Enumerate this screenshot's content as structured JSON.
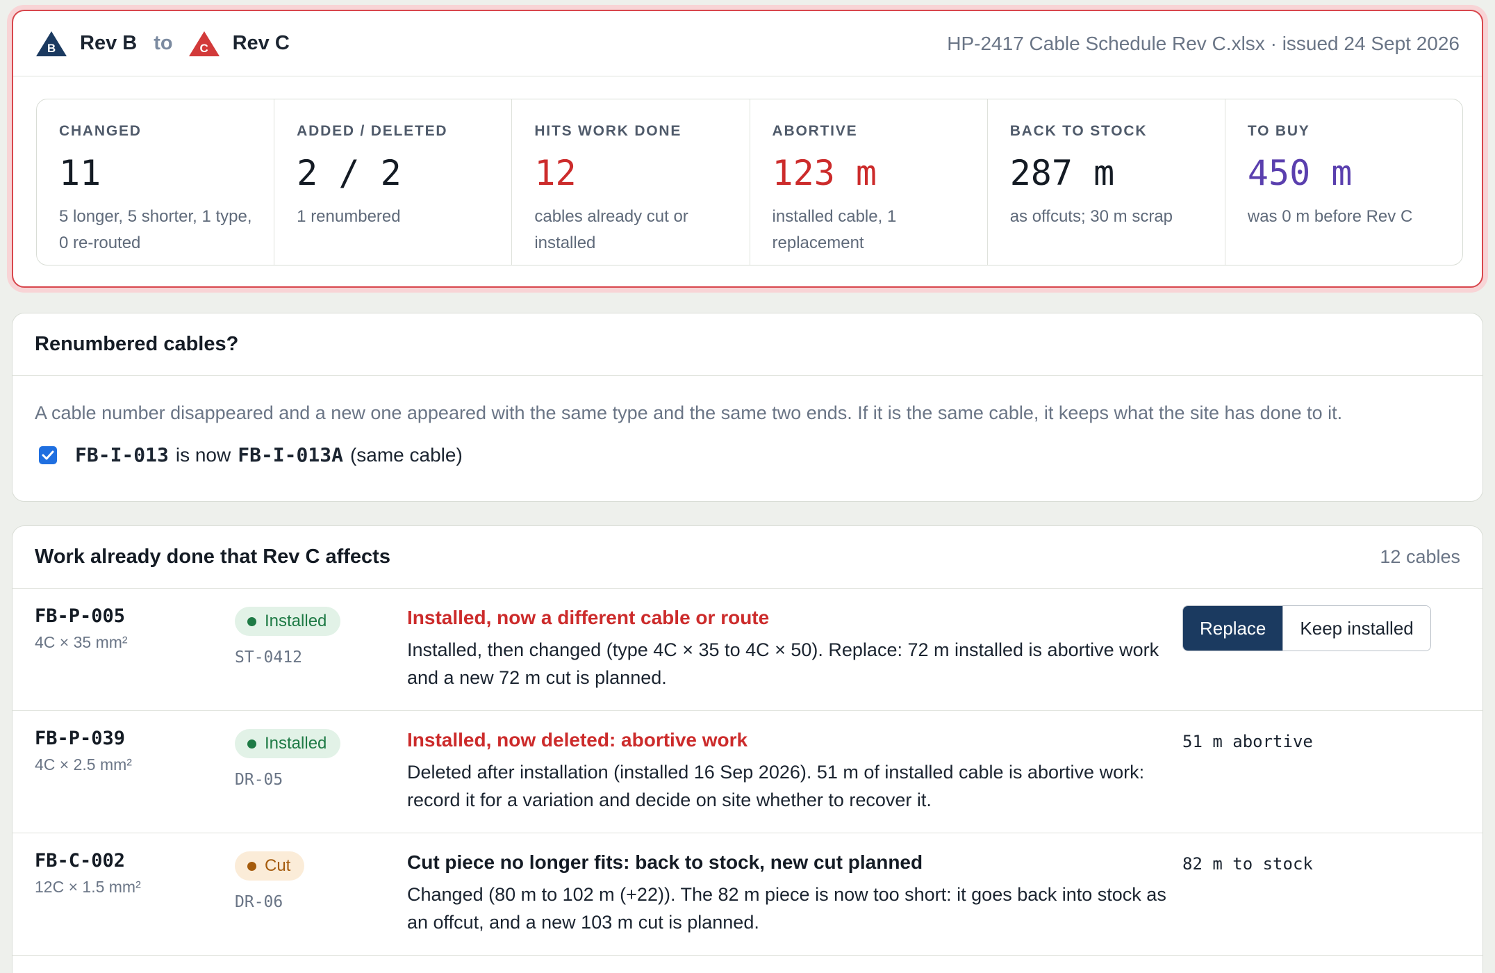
{
  "comparison": {
    "from_badge": "B",
    "from_label": "Rev B",
    "to_word": "to",
    "to_badge": "C",
    "to_label": "Rev C",
    "file_info": "HP-2417 Cable Schedule Rev C.xlsx · issued 24 Sept 2026",
    "colors": {
      "rev_b": "#1b3a60",
      "rev_c": "#d23a3a",
      "highlight_border": "#d8474d"
    }
  },
  "stats": [
    {
      "label": "Changed",
      "value": "11",
      "note": "5 longer, 5 shorter, 1 type, 0 re-routed"
    },
    {
      "label": "Added / Deleted",
      "value": "2 / 2",
      "note": "1 renumbered"
    },
    {
      "label": "Hits work done",
      "value": "12",
      "note": "cables already cut or installed"
    },
    {
      "label": "Abortive",
      "value": "123 m",
      "note": "installed cable, 1 replacement"
    },
    {
      "label": "Back to stock",
      "value": "287 m",
      "note": "as offcuts; 30 m scrap"
    },
    {
      "label": "To buy",
      "value": "450 m",
      "note": "was 0 m before Rev C"
    }
  ],
  "renumbered": {
    "title": "Renumbered cables?",
    "description": "A cable number disappeared and a new one appeared with the same type and the same two ends. If it is the same cable, it keeps what the site has done to it.",
    "item": {
      "checked": true,
      "old_id": "FB-I-013",
      "middle": "is now",
      "new_id": "FB-I-013A",
      "suffix": "(same cable)"
    }
  },
  "work": {
    "title": "Work already done that Rev C affects",
    "count": "12 cables",
    "rows": [
      {
        "cable_id": "FB-P-005",
        "cable_type": "4C × 35 mm²",
        "status": "Installed",
        "location": "ST-0412",
        "issue_title": "Installed, now a different cable or route",
        "issue_desc": "Installed, then changed (type 4C × 35 to 4C × 50). Replace: 72 m installed is abortive work and a new 72 m cut is planned.",
        "actions": [
          "Replace",
          "Keep installed"
        ]
      },
      {
        "cable_id": "FB-P-039",
        "cable_type": "4C × 2.5 mm²",
        "status": "Installed",
        "location": "DR-05",
        "issue_title": "Installed, now deleted: abortive work",
        "issue_desc": "Deleted after installation (installed 16 Sep 2026). 51 m of installed cable is abortive work: record it for a variation and decide on site whether to recover it.",
        "right_text": "51 m abortive"
      },
      {
        "cable_id": "FB-C-002",
        "cable_type": "12C × 1.5 mm²",
        "status": "Cut",
        "location": "DR-06",
        "issue_title": "Cut piece no longer fits: back to stock, new cut planned",
        "issue_desc": "Changed (80 m to 102 m (+22)). The 82 m piece is now too short: it goes back into stock as an offcut, and a new 103 m cut is planned.",
        "right_text": "82 m to stock"
      }
    ]
  }
}
